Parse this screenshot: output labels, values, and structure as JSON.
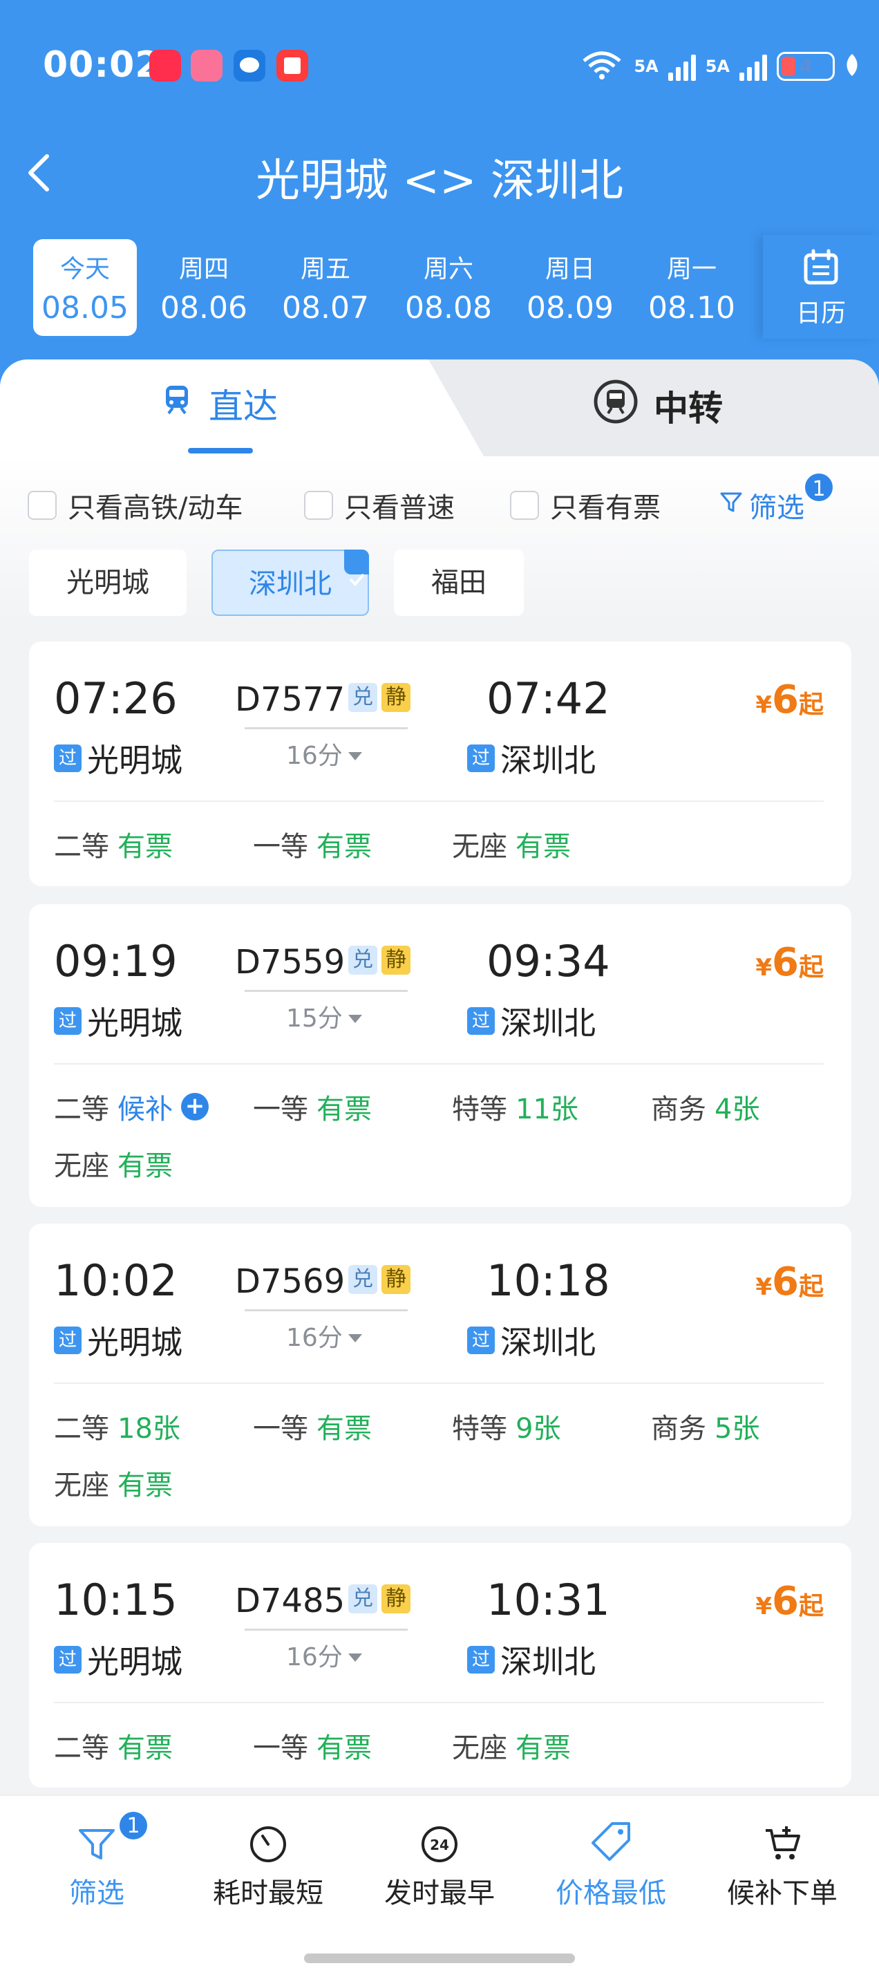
{
  "status_bar": {
    "time": "00:02",
    "apps": [
      "xiaohongshu-icon",
      "bilibili-icon",
      "message-icon",
      "reader-icon"
    ],
    "network": [
      "6",
      "5A",
      "5A"
    ],
    "battery": "4"
  },
  "nav": {
    "title": "光明城 <> 深圳北"
  },
  "dates": [
    {
      "weekday": "今天",
      "date": "08.05",
      "active": true
    },
    {
      "weekday": "周四",
      "date": "08.06"
    },
    {
      "weekday": "周五",
      "date": "08.07"
    },
    {
      "weekday": "周六",
      "date": "08.08"
    },
    {
      "weekday": "周日",
      "date": "08.09"
    },
    {
      "weekday": "周一",
      "date": "08.10"
    }
  ],
  "calendar_label": "日历",
  "tabs": {
    "direct": "直达",
    "transfer": "中转"
  },
  "filters": {
    "hsr_only": "只看高铁/动车",
    "normal_only": "只看普速",
    "available_only": "只看有票",
    "filter_label": "筛选",
    "filter_count": "1"
  },
  "stations": [
    "光明城",
    "深圳北",
    "福田"
  ],
  "trains": [
    {
      "dep_time": "07:26",
      "arr_time": "07:42",
      "train_no": "D7577",
      "tag1": "兑",
      "tag2": "静",
      "duration": "16分",
      "pass_tag": "过",
      "from": "光明城",
      "to": "深圳北",
      "price_cur": "¥",
      "price": "6",
      "price_suffix": "起",
      "seats": [
        {
          "cls": "二等",
          "status": "有票"
        },
        {
          "cls": "一等",
          "status": "有票"
        },
        {
          "cls": "无座",
          "status": "有票"
        }
      ]
    },
    {
      "dep_time": "09:19",
      "arr_time": "09:34",
      "train_no": "D7559",
      "tag1": "兑",
      "tag2": "静",
      "duration": "15分",
      "pass_tag": "过",
      "from": "光明城",
      "to": "深圳北",
      "price_cur": "¥",
      "price": "6",
      "price_suffix": "起",
      "seats": [
        {
          "cls": "二等",
          "status": "候补"
        },
        {
          "cls": "一等",
          "status": "有票"
        },
        {
          "cls": "特等",
          "status": "11张"
        },
        {
          "cls": "商务",
          "status": "4张"
        },
        {
          "cls": "无座",
          "status": "有票"
        }
      ]
    },
    {
      "dep_time": "10:02",
      "arr_time": "10:18",
      "train_no": "D7569",
      "tag1": "兑",
      "tag2": "静",
      "duration": "16分",
      "pass_tag": "过",
      "from": "光明城",
      "to": "深圳北",
      "price_cur": "¥",
      "price": "6",
      "price_suffix": "起",
      "seats": [
        {
          "cls": "二等",
          "status": "18张"
        },
        {
          "cls": "一等",
          "status": "有票"
        },
        {
          "cls": "特等",
          "status": "9张"
        },
        {
          "cls": "商务",
          "status": "5张"
        },
        {
          "cls": "无座",
          "status": "有票"
        }
      ]
    },
    {
      "dep_time": "10:15",
      "arr_time": "10:31",
      "train_no": "D7485",
      "tag1": "兑",
      "tag2": "静",
      "duration": "16分",
      "pass_tag": "过",
      "from": "光明城",
      "to": "深圳北",
      "price_cur": "¥",
      "price": "6",
      "price_suffix": "起",
      "seats": [
        {
          "cls": "二等",
          "status": "有票"
        },
        {
          "cls": "一等",
          "status": "有票"
        },
        {
          "cls": "无座",
          "status": "有票"
        }
      ]
    }
  ],
  "bottom_bar": {
    "filter": "筛选",
    "filter_count": "1",
    "shortest": "耗时最短",
    "earliest": "发时最早",
    "earliest_icon_text": "24",
    "lowest_price": "价格最低",
    "waitlist": "候补下单"
  },
  "colors": {
    "primary": "#3d95f0",
    "available": "#23b05a",
    "price": "#f07a14",
    "tag_jing": "#f9cf4b"
  }
}
